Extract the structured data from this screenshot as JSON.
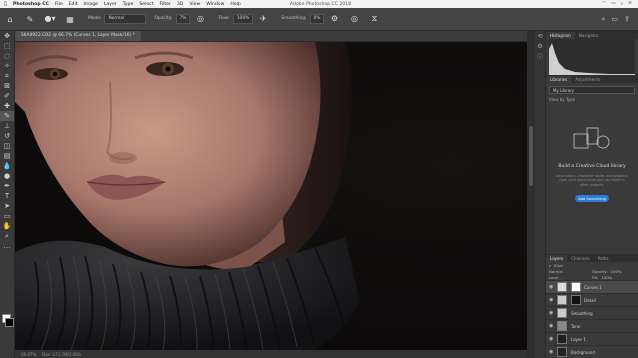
{
  "menubar": {
    "items": [
      "Photoshop CC",
      "File",
      "Edit",
      "Image",
      "Layer",
      "Type",
      "Select",
      "Filter",
      "3D",
      "View",
      "Window",
      "Help"
    ],
    "window_title": "Adobe Photoshop CC 2018"
  },
  "options": {
    "mode_label": "Mode:",
    "mode_value": "Normal",
    "opacity_label": "Opacity:",
    "opacity_value": "7%",
    "flow_label": "Flow:",
    "flow_value": "100%",
    "smoothing_label": "Smoothing:",
    "smoothing_value": "0%"
  },
  "document": {
    "tab_title": "56A4922.CR2 @ 66.7% (Curves 1, Layer Mask/16) *"
  },
  "status": {
    "zoom": "66.67%",
    "doc": "Doc: 171.7M/1.08G"
  },
  "panels": {
    "top_tabs": [
      "Histogram",
      "Navigator"
    ],
    "mid_tabs": [
      "Libraries",
      "Adjustments"
    ],
    "library_select": "My Library",
    "library_sub": "View by Type",
    "library_heading": "Build a Creative Cloud library",
    "library_desc": "Save colors, character styles and graphics from your documents and use them in other projects.",
    "library_button": "Add Something",
    "layer_tabs": [
      "Layers",
      "Channels",
      "Paths"
    ],
    "kind_filter": "Kind",
    "blend_mode": "Normal",
    "opacity_label": "Opacity:",
    "opacity_value": "100%",
    "lock_label": "Lock:",
    "fill_label": "Fill:",
    "fill_value": "100%"
  },
  "layers": [
    {
      "name": "Curves 1",
      "selected": true
    },
    {
      "name": "Detail",
      "selected": false
    },
    {
      "name": "Smoothing",
      "selected": false
    },
    {
      "name": "Tone",
      "selected": false
    },
    {
      "name": "Layer 1",
      "selected": false
    },
    {
      "name": "Background",
      "selected": false
    }
  ],
  "colors": {
    "accent": "#2d7bd6",
    "panel": "#3a3a3a",
    "canvas_bg": "#0c0a0a"
  }
}
